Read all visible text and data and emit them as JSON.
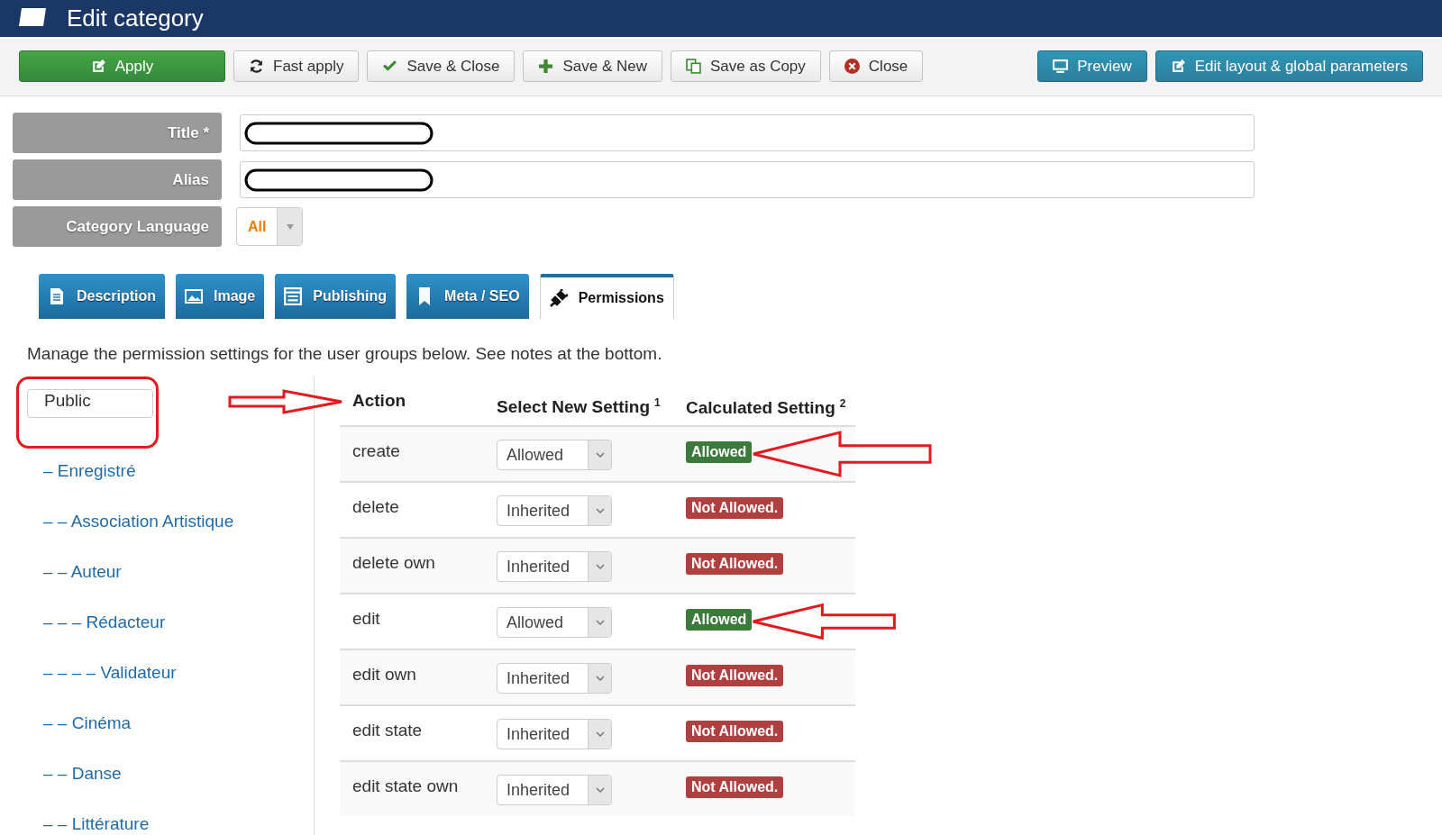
{
  "header": {
    "title": "Edit category"
  },
  "toolbar": {
    "buttons": [
      {
        "label": "Apply",
        "kind": "success"
      },
      {
        "label": "Fast apply",
        "kind": "default"
      },
      {
        "label": "Save & Close",
        "kind": "default"
      },
      {
        "label": "Save & New",
        "kind": "default"
      },
      {
        "label": "Save as Copy",
        "kind": "default"
      },
      {
        "label": "Close",
        "kind": "default"
      }
    ],
    "right_buttons": [
      {
        "label": "Preview",
        "kind": "info"
      },
      {
        "label": "Edit layout & global parameters",
        "kind": "info"
      }
    ]
  },
  "form": {
    "fields": [
      {
        "label": "Title *",
        "kind": "redacted"
      },
      {
        "label": "Alias",
        "kind": "redacted"
      },
      {
        "label": "Category Language",
        "kind": "select",
        "value": "All"
      }
    ]
  },
  "tabs": [
    {
      "label": "Description",
      "selected": false
    },
    {
      "label": "Image",
      "selected": false
    },
    {
      "label": "Publishing",
      "selected": false
    },
    {
      "label": "Meta / SEO",
      "selected": false
    },
    {
      "label": "Permissions",
      "selected": true
    }
  ],
  "description": "Manage the permission settings for the user groups below. See notes at the bottom.",
  "groups": [
    {
      "name": "Public",
      "selected": true,
      "highlighted": true,
      "children": [
        {
          "name": "Enregistré",
          "prefix": "–",
          "selected": false,
          "children": [
            {
              "name": "Association Artistique",
              "prefix": "– –",
              "selected": false
            },
            {
              "name": "Auteur",
              "prefix": "– –",
              "selected": false,
              "children": [
                {
                  "name": "Rédacteur",
                  "prefix": "– – –",
                  "selected": false,
                  "children": [
                    {
                      "name": "Validateur",
                      "prefix": "– – – –",
                      "selected": false
                    }
                  ]
                }
              ]
            },
            {
              "name": "Cinéma",
              "prefix": "– –",
              "selected": false
            },
            {
              "name": "Danse",
              "prefix": "– –",
              "selected": false
            },
            {
              "name": "Littérature",
              "prefix": "– –",
              "selected": false
            }
          ]
        }
      ]
    }
  ],
  "table": {
    "header_arrow": true,
    "columns": [
      {
        "label": "Action"
      },
      {
        "label": "Select New Setting",
        "note": "1"
      },
      {
        "label": "Calculated Setting",
        "note": "2"
      }
    ],
    "rows": [
      {
        "action": "create",
        "setting": "Allowed",
        "calculated": "Allowed",
        "kind": "allowed",
        "highlighted": true
      },
      {
        "action": "delete",
        "setting": "Inherited",
        "calculated": "Not Allowed.",
        "kind": "denied",
        "highlighted": false
      },
      {
        "action": "delete own",
        "setting": "Inherited",
        "calculated": "Not Allowed.",
        "kind": "denied",
        "highlighted": false
      },
      {
        "action": "edit",
        "setting": "Allowed",
        "calculated": "Allowed",
        "kind": "allowed",
        "highlighted": true
      },
      {
        "action": "edit own",
        "setting": "Inherited",
        "calculated": "Not Allowed.",
        "kind": "denied",
        "highlighted": false
      },
      {
        "action": "edit state",
        "setting": "Inherited",
        "calculated": "Not Allowed.",
        "kind": "denied",
        "highlighted": false
      },
      {
        "action": "edit state own",
        "setting": "Inherited",
        "calculated": "Not Allowed.",
        "kind": "denied",
        "highlighted": false
      }
    ]
  }
}
